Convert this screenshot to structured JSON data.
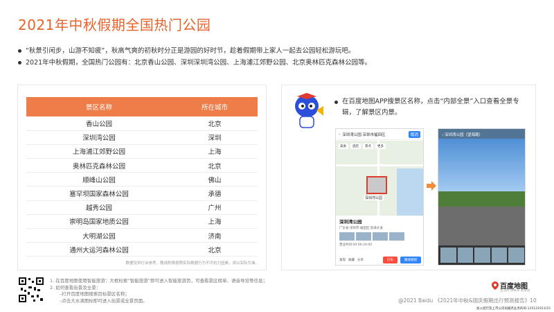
{
  "title": "2021年中秋假期全国热门公园",
  "bullets": [
    "“秋景引闲步，山游不知疲”，秋高气爽的初秋时分正是游园的好时节，趁着假期带上家人一起去公园轻松游玩吧。",
    "2021年中秋假期，全国热门公园有：北京香山公园、深圳深圳湾公园、上海浦江郊野公园、北京奥林匹克森林公园等。"
  ],
  "table": {
    "headers": [
      "景区名称",
      "所在城市"
    ],
    "rows": [
      [
        "香山公园",
        "北京"
      ],
      [
        "深圳湾公园",
        "深圳"
      ],
      [
        "上海浦江郊野公园",
        "上海"
      ],
      [
        "奥林匹克森林公园",
        "北京"
      ],
      [
        "顺峰山公园",
        "佛山"
      ],
      [
        "塞罕坝国家森林公园",
        "承德"
      ],
      [
        "越秀公园",
        "广州"
      ],
      [
        "崇明岛国家地质公园",
        "上海"
      ],
      [
        "大明湖公园",
        "济南"
      ],
      [
        "通州大运河森林公园",
        "北京"
      ]
    ],
    "note": "数据仅供行业参考，敬请酌情按照实际数据行为不可杭力因素，请以实际为准。"
  },
  "instruction": "在百度地图APP搜景区名称，点击“内部全景”入口查看全景专辑，了解景区内景。",
  "phone": {
    "search": "深圳湾公园·深圳市福田区",
    "cancel": "取消",
    "tabs": [
      "美食",
      "酒店",
      "景点",
      "更多"
    ],
    "poi_label": "深圳湾公园",
    "place_name": "深圳湾公园",
    "place_sub": "广东省·深圳市·福田区·滨海大道",
    "hours": "营业时间:00:00-24:00",
    "actions": [
      "发现",
      "收藏",
      "分享"
    ],
    "btn_route": "打车",
    "btn_nav": "路线规划"
  },
  "pano": {
    "title": "深圳湾公园（望海路）"
  },
  "footer": {
    "lines": [
      "1.  在百度地图使用智能旅游：大框检索“智能旅游”即可进入智能旅游页，可查看景区榜单、语音导览等信息；",
      "2.  如何查看街景及全景：",
      "–打开百度地图搜索目标景区名称；",
      "–点击大水滴图标即可进入街景或全景页面。"
    ],
    "brand": "百度地图",
    "brand_sub": "生活的 你每天 就身边",
    "copyright": "@2021 Baidu 《2021年中秋&国庆假期出行预测报告》10",
    "reg": "加入招行及上市公司局服务业务的ID:135121913/15"
  },
  "colors": {
    "accent": "#e8622a",
    "table_header": "#ef7d4a",
    "map_red": "#e03a2f",
    "map_blue": "#3385ff"
  }
}
